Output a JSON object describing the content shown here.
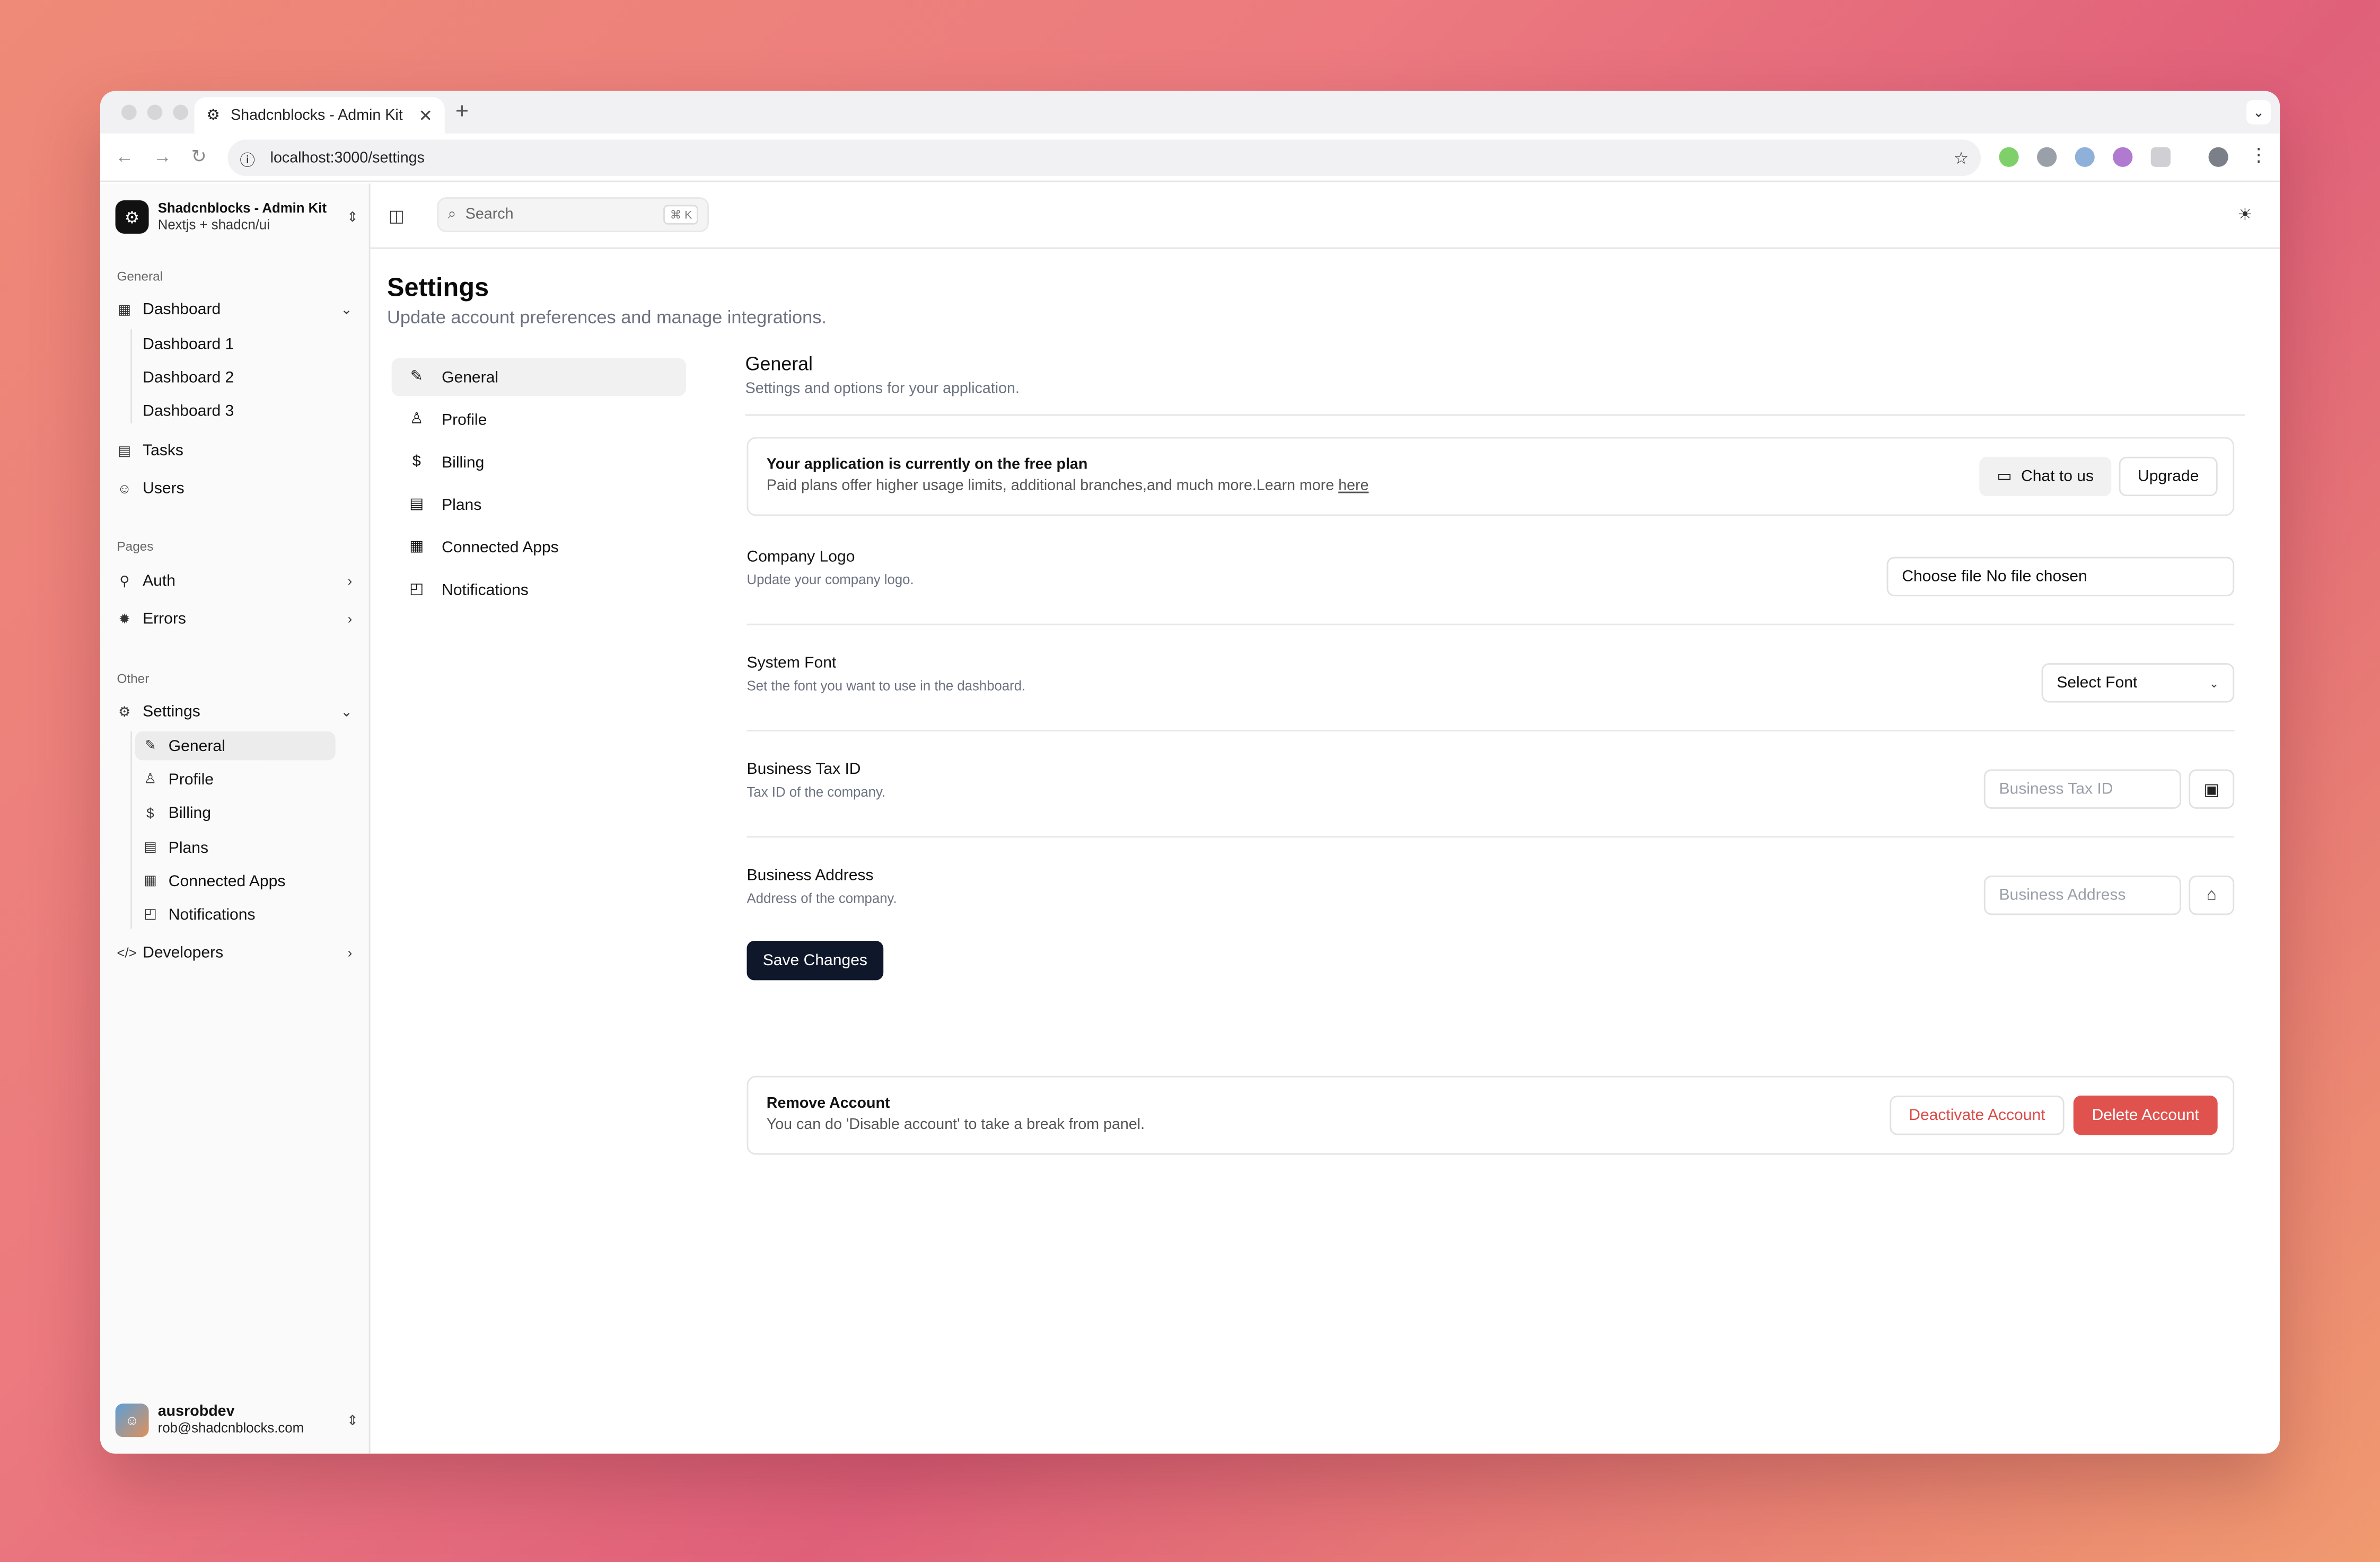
{
  "browser": {
    "tab_title": "Shadcnblocks - Admin Kit",
    "tab_close": "✕",
    "new_tab": "+",
    "url": "localhost:3000/settings"
  },
  "sidebar": {
    "team": {
      "name": "Shadcnblocks - Admin Kit",
      "subtitle": "Nextjs + shadcn/ui"
    },
    "groups": {
      "general": "General",
      "pages": "Pages",
      "other": "Other"
    },
    "items": {
      "dashboard": "Dashboard",
      "dashboard1": "Dashboard 1",
      "dashboard2": "Dashboard 2",
      "dashboard3": "Dashboard 3",
      "tasks": "Tasks",
      "users": "Users",
      "auth": "Auth",
      "errors": "Errors",
      "settings": "Settings",
      "general": "General",
      "profile": "Profile",
      "billing": "Billing",
      "plans": "Plans",
      "connected_apps": "Connected Apps",
      "notifications": "Notifications",
      "developers": "Developers"
    },
    "user": {
      "name": "ausrobdev",
      "email": "rob@shadcnblocks.com"
    }
  },
  "topbar": {
    "search_placeholder": "Search",
    "shortcut": "⌘ K"
  },
  "page": {
    "title": "Settings",
    "subtitle": "Update account preferences and manage integrations."
  },
  "settings_nav": {
    "general": "General",
    "profile": "Profile",
    "billing": "Billing",
    "plans": "Plans",
    "connected_apps": "Connected Apps",
    "notifications": "Notifications"
  },
  "general": {
    "title": "General",
    "subtitle": "Settings and options for your application.",
    "plan": {
      "title": "Your application is currently on the free plan",
      "description": "Paid plans offer higher usage limits, additional branches,and much more.Learn more",
      "link": "here",
      "chat_button": "Chat to us",
      "upgrade_button": "Upgrade"
    },
    "logo": {
      "label": "Company Logo",
      "sub": "Update your company logo.",
      "choose": "Choose file",
      "status": "No file chosen"
    },
    "font": {
      "label": "System Font",
      "sub": "Set the font you want to use in the dashboard.",
      "selected": "Select Font"
    },
    "tax": {
      "label": "Business Tax ID",
      "sub": "Tax ID of the company.",
      "placeholder": "Business Tax ID"
    },
    "address": {
      "label": "Business Address",
      "sub": "Address of the company.",
      "placeholder": "Business Address"
    },
    "save_button": "Save Changes",
    "remove": {
      "title": "Remove Account",
      "description": "You can do 'Disable account' to take a break from panel.",
      "deactivate_button": "Deactivate Account",
      "delete_button": "Delete Account"
    }
  },
  "colors": {
    "primary": "#0f172a",
    "danger": "#e0524d",
    "danger_text": "#dc4a48"
  }
}
